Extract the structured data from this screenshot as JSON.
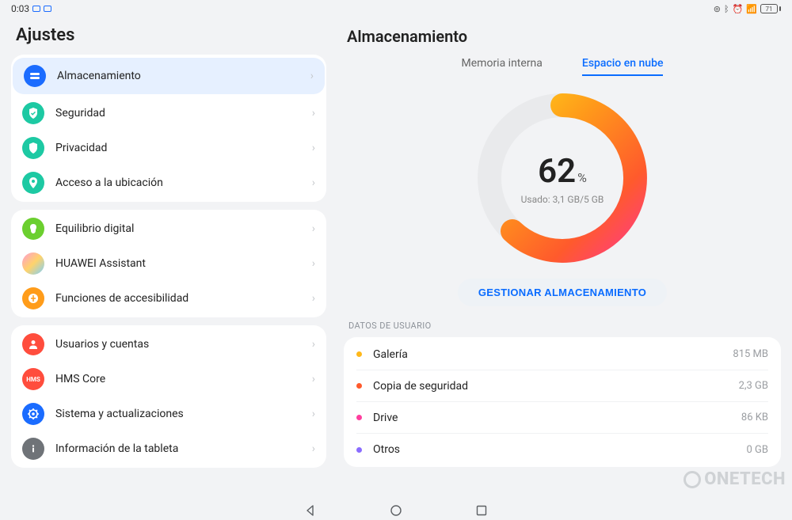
{
  "status": {
    "time": "0:03",
    "battery_pct": "71"
  },
  "settings_title": "Ajustes",
  "detail_title": "Almacenamiento",
  "groups": [
    [
      {
        "key": "storage",
        "label": "Almacenamiento",
        "icon_bg": "#1b6cff",
        "selected": true
      },
      {
        "key": "security",
        "label": "Seguridad",
        "icon_bg": "#1dc9a3",
        "selected": false
      },
      {
        "key": "privacy",
        "label": "Privacidad",
        "icon_bg": "#1dc9a3",
        "selected": false
      },
      {
        "key": "location",
        "label": "Acceso a la ubicación",
        "icon_bg": "#1dc9a3",
        "selected": false
      }
    ],
    [
      {
        "key": "digital-balance",
        "label": "Equilibrio digital",
        "icon_bg": "#6bcf2f",
        "selected": false
      },
      {
        "key": "assistant",
        "label": "HUAWEI Assistant",
        "icon_bg": "linear-gradient(135deg,#ff9bd2,#ffd36b,#7bd0ff)",
        "selected": false
      },
      {
        "key": "accessibility",
        "label": "Funciones de accesibilidad",
        "icon_bg": "#ff9c1a",
        "selected": false
      }
    ],
    [
      {
        "key": "users",
        "label": "Usuarios y cuentas",
        "icon_bg": "#ff4d3d",
        "selected": false
      },
      {
        "key": "hms",
        "label": "HMS Core",
        "icon_bg": "#ff4d3d",
        "selected": false
      },
      {
        "key": "system",
        "label": "Sistema y actualizaciones",
        "icon_bg": "#1b6cff",
        "selected": false
      },
      {
        "key": "about",
        "label": "Información de la tableta",
        "icon_bg": "#6f7378",
        "selected": false
      }
    ]
  ],
  "tabs": {
    "internal": "Memoria interna",
    "cloud": "Espacio en nube",
    "active": "cloud"
  },
  "chart_data": {
    "type": "pie",
    "title": "",
    "percent": 62,
    "used_label": "Usado: 3,1 GB/5 GB",
    "track_color": "#e9eaec",
    "gradient": [
      "#ff3e7f",
      "#ff5a2c",
      "#ff9a1a",
      "#ffd21a"
    ]
  },
  "manage_label": "GESTIONAR ALMACENAMIENTO",
  "user_data_head": "DATOS DE USUARIO",
  "user_data": [
    {
      "label": "Galería",
      "value": "815 MB",
      "color": "#ffb81a"
    },
    {
      "label": "Copia de seguridad",
      "value": "2,3 GB",
      "color": "#ff5a2c"
    },
    {
      "label": "Drive",
      "value": "86 KB",
      "color": "#ff3e9e"
    },
    {
      "label": "Otros",
      "value": "0 GB",
      "color": "#8a6cff"
    }
  ],
  "watermark": "ONETECH"
}
